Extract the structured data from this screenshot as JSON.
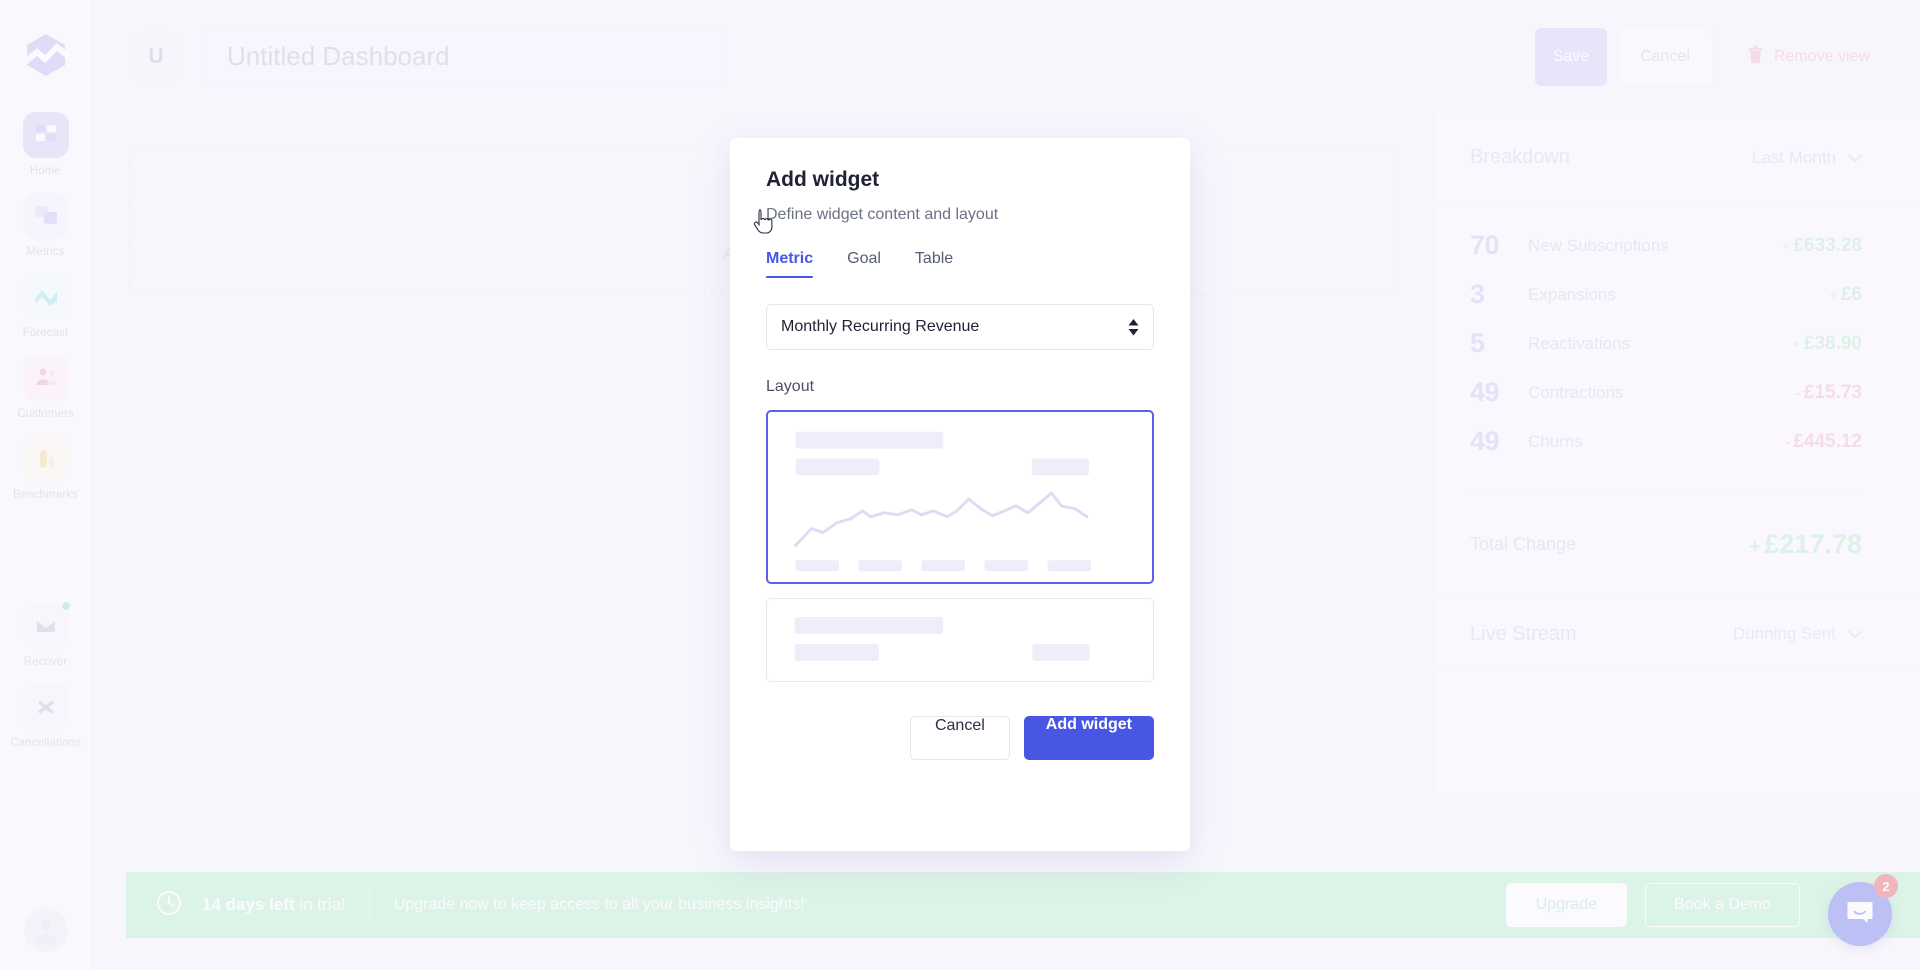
{
  "app": {
    "logo_icon": "chartmogul-logo-icon"
  },
  "sidebar": {
    "items": [
      {
        "label": "Home",
        "icon": "grid-icon",
        "active": true
      },
      {
        "label": "Metrics",
        "icon": "squares-icon",
        "active": false
      },
      {
        "label": "Forecast",
        "icon": "wave-icon",
        "active": false
      },
      {
        "label": "Customers",
        "icon": "people-icon",
        "active": false
      },
      {
        "label": "Benchmarks",
        "icon": "bars-icon",
        "active": false
      },
      {
        "label": "Recover",
        "icon": "envelope-icon",
        "active": false,
        "badge_dot": true
      },
      {
        "label": "Cancellations",
        "icon": "scissors-icon",
        "active": false
      }
    ],
    "avatar_icon": "user-avatar-icon"
  },
  "header": {
    "badge_letter": "U",
    "title_value": "Untitled Dashboard",
    "title_placeholder": "Untitled Dashboard",
    "save_label": "Save",
    "cancel_label": "Cancel",
    "remove_label": "Remove view",
    "trash_icon": "trash-icon"
  },
  "canvas": {
    "placeholder_label": "Add widget",
    "plus_icon": "plus-circle-icon"
  },
  "modal": {
    "title": "Add widget",
    "subtitle": "Define widget content and layout",
    "tabs": [
      {
        "label": "Metric",
        "active": true
      },
      {
        "label": "Goal",
        "active": false
      },
      {
        "label": "Table",
        "active": false
      }
    ],
    "metric_select": {
      "value": "Monthly Recurring Revenue",
      "options": [
        "Monthly Recurring Revenue"
      ],
      "caret_icon": "updown-caret-icon"
    },
    "layout_label": "Layout",
    "layout_options": [
      {
        "name": "chart-layout",
        "selected": true
      },
      {
        "name": "metric-layout",
        "selected": false
      }
    ],
    "cancel_label": "Cancel",
    "submit_label": "Add widget"
  },
  "breakdown": {
    "title": "Breakdown",
    "period": "Last Month",
    "period_caret_icon": "chevron-down-icon",
    "rows": [
      {
        "count": "70",
        "label": "New Subscriptions",
        "sign": "+",
        "amount": "£633.28",
        "direction": "positive"
      },
      {
        "count": "3",
        "label": "Expansions",
        "sign": "+",
        "amount": "£6",
        "direction": "positive"
      },
      {
        "count": "5",
        "label": "Reactivations",
        "sign": "+",
        "amount": "£38.90",
        "direction": "positive"
      },
      {
        "count": "49",
        "label": "Contractions",
        "sign": "-",
        "amount": "£15.73",
        "direction": "negative"
      },
      {
        "count": "49",
        "label": "Churns",
        "sign": "-",
        "amount": "£445.12",
        "direction": "negative"
      }
    ],
    "total_label": "Total Change",
    "total_sign": "+",
    "total_amount": "£217.78"
  },
  "live_stream": {
    "title": "Live Stream",
    "filter": "Dunning Sent",
    "filter_caret_icon": "chevron-down-icon"
  },
  "trial_banner": {
    "clock_icon": "clock-icon",
    "days_bold": "14 days left",
    "days_light": " in trial",
    "message": "Upgrade now to keep access to all your business insights!",
    "upgrade_label": "Upgrade",
    "demo_label": "Book a Demo"
  },
  "intercom": {
    "icon": "chat-bubble-icon",
    "badge_count": "2"
  },
  "colors": {
    "accent": "#4757e3",
    "positive": "#a6e5bd",
    "negative": "#f1a6c0",
    "banner": "#a5e9bd",
    "badge": "#e0393e"
  }
}
